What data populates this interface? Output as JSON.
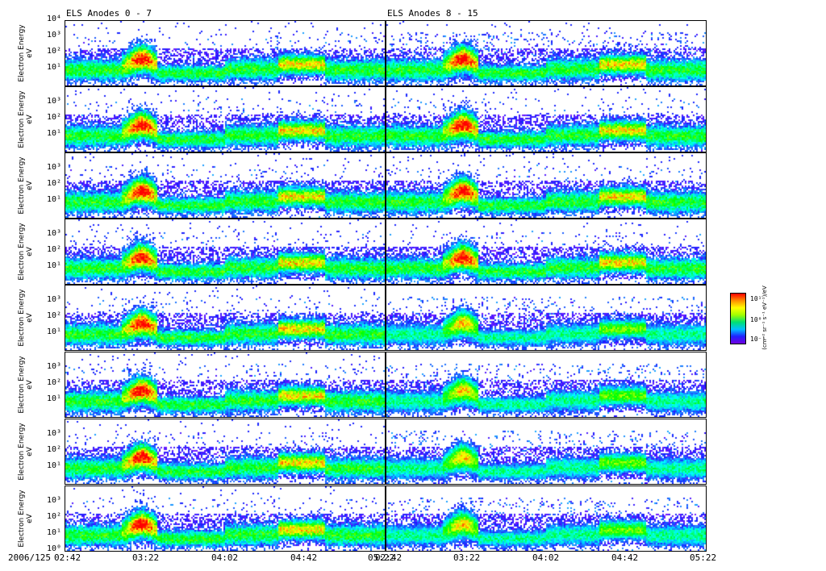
{
  "chart_data": {
    "type": "heatmap",
    "titles": [
      "ELS Anodes 0 - 7",
      "ELS Anodes 8 - 15"
    ],
    "ylabel": "Electron Energy\neV",
    "ylabel_line1": "Electron Energy",
    "ylabel_line2": "eV",
    "yscale": "log",
    "ylim": [
      1,
      10000
    ],
    "yticks": [
      "10⁰",
      "10¹",
      "10²",
      "10³",
      "10⁴"
    ],
    "xlabel_prefix": "2006/125",
    "xticks": [
      "02:42",
      "03:22",
      "04:02",
      "04:42",
      "05:22"
    ],
    "xlim": [
      "02:42",
      "05:22"
    ],
    "panels_per_column": 8,
    "anodes_left": [
      0,
      1,
      2,
      3,
      4,
      5,
      6,
      7
    ],
    "anodes_right": [
      8,
      9,
      10,
      11,
      12,
      13,
      14,
      15
    ],
    "features": [
      {
        "time": "03:10-03:27",
        "peak_energy_eV": 50,
        "level": "high"
      },
      {
        "time": "03:28-04:00",
        "peak_energy_eV": 6,
        "level": "medium"
      },
      {
        "time": "04:28-04:52",
        "peak_energy_eV": 30,
        "level": "high"
      }
    ],
    "colorbar": {
      "ticks": [
        "10⁻¹",
        "10⁰",
        "10¹"
      ],
      "label": "(cm⁻² sr⁻¹ s⁻¹ eV⁻¹)/eV"
    }
  }
}
